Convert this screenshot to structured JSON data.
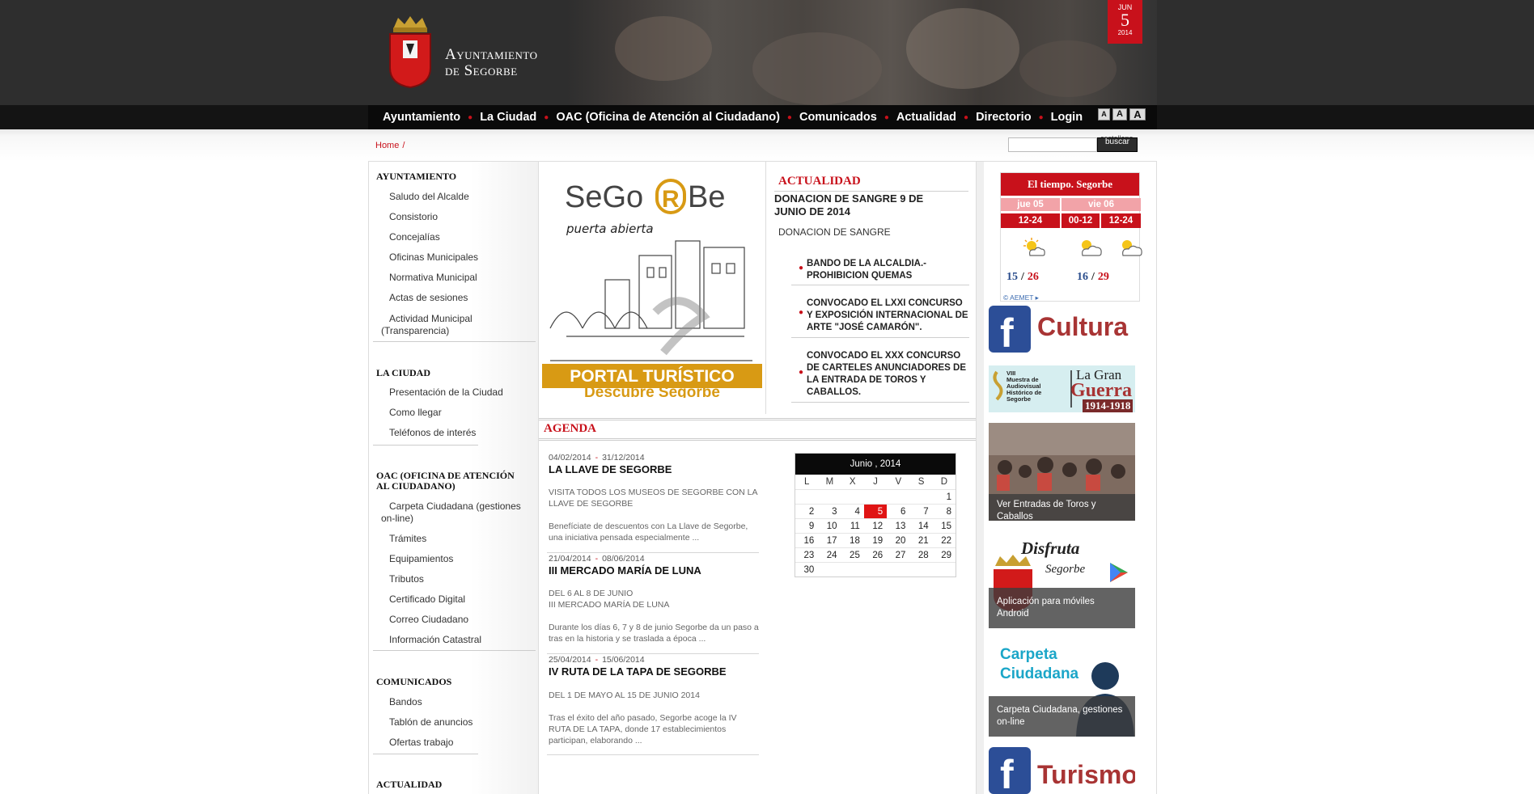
{
  "header": {
    "site_title_line1": "Ayuntamiento",
    "site_title_line2": "de Segorbe",
    "date": {
      "month": "JUN",
      "day": "5",
      "year": "2014"
    }
  },
  "nav": {
    "items": [
      "Ayuntamiento",
      "La Ciudad",
      "OAC (Oficina de Atención al Ciudadano)",
      "Comunicados",
      "Actualidad",
      "Directorio",
      "Login"
    ],
    "font_sizes": [
      "A",
      "A",
      "A"
    ]
  },
  "breadcrumb": {
    "home": "Home",
    "sep": "/"
  },
  "search": {
    "lang": "castellano",
    "button": "buscar",
    "placeholder": ""
  },
  "sidebar": {
    "sections": [
      {
        "title": "AYUNTAMIENTO",
        "items": [
          "Saludo del Alcalde",
          "Consistorio",
          "Concejalías",
          "Oficinas Municipales",
          "Normativa Municipal",
          "Actas de sesiones",
          "Actividad Municipal",
          "(Transparencia)"
        ]
      },
      {
        "title": "LA CIUDAD",
        "items": [
          "Presentación de la Ciudad",
          "Como llegar",
          "Teléfonos de interés"
        ]
      },
      {
        "title_line1": "OAC (OFICINA DE ATENCIÓN",
        "title_line2": "AL CIUDADANO)",
        "items": [
          "Carpeta Ciudadana (gestiones",
          "on-line)",
          "Trámites",
          "Equipamientos",
          "Tributos",
          "Certificado Digital",
          "Correo Ciudadano",
          "Información Catastral"
        ]
      },
      {
        "title": "COMUNICADOS",
        "items": [
          "Bandos",
          "Tablón de anuncios",
          "Ofertas trabajo"
        ]
      },
      {
        "title": "ACTUALIDAD"
      }
    ]
  },
  "portal": {
    "brand_a": "SeGo",
    "brand_b": "Be",
    "tagline": "puerta abierta",
    "banner_title": "PORTAL TURÍSTICO",
    "banner_sub": "Descubre Segorbe"
  },
  "actualidad": {
    "title": "ACTUALIDAD",
    "main_title": "DONACION DE SANGRE 9 DE JUNIO DE 2014",
    "main_sub": "DONACION DE SANGRE",
    "items": [
      "BANDO DE LA ALCALDIA.- PROHIBICION QUEMAS",
      "CONVOCADO EL LXXI CONCURSO Y EXPOSICIÓN INTERNACIONAL DE ARTE \"JOSÉ CAMARÓN\".",
      "CONVOCADO EL XXX CONCURSO DE CARTELES ANUNCIADORES DE LA ENTRADA DE TOROS Y CABALLOS."
    ]
  },
  "agenda": {
    "title": "AGENDA",
    "events": [
      {
        "from": "04/02/2014",
        "to": "31/12/2014",
        "title": "LA LLAVE DE SEGORBE",
        "sub": "VISITA TODOS LOS MUSEOS DE SEGORBE CON LA LLAVE DE SEGORBE",
        "text": "Benefíciate de descuentos con La Llave de Segorbe, una iniciativa pensada especialmente ..."
      },
      {
        "from": "21/04/2014",
        "to": "08/06/2014",
        "title": "III MERCADO MARÍA DE LUNA",
        "sub_line1": "DEL 6 AL 8 DE JUNIO",
        "sub_line2": "III MERCADO MARÍA DE LUNA",
        "text": "Durante los días 6, 7 y 8 de junio Segorbe da un paso a tras en la historia y se traslada a época ..."
      },
      {
        "from": "25/04/2014",
        "to": "15/06/2014",
        "title": "IV RUTA DE LA TAPA DE SEGORBE",
        "sub": "DEL 1 DE MAYO AL 15 DE JUNIO 2014",
        "text": "Tras el éxito del año pasado, Segorbe acoge la IV RUTA DE LA TAPA, donde 17 establecimientos participan, elaborando ..."
      }
    ]
  },
  "calendar": {
    "title": "Junio , 2014",
    "dow": [
      "L",
      "M",
      "X",
      "J",
      "V",
      "S",
      "D"
    ],
    "weeks": [
      [
        "",
        "",
        "",
        "",
        "",
        "",
        "1"
      ],
      [
        "2",
        "3",
        "4",
        "5",
        "6",
        "7",
        "8"
      ],
      [
        "9",
        "10",
        "11",
        "12",
        "13",
        "14",
        "15"
      ],
      [
        "16",
        "17",
        "18",
        "19",
        "20",
        "21",
        "22"
      ],
      [
        "23",
        "24",
        "25",
        "26",
        "27",
        "28",
        "29"
      ],
      [
        "30",
        "",
        "",
        "",
        "",
        "",
        ""
      ]
    ],
    "today": "5",
    "today_color": "#e01414"
  },
  "weather": {
    "title": "El tiempo. Segorbe",
    "days": [
      "jue 05",
      "vie 06"
    ],
    "hours": [
      "12-24",
      "00-12",
      "12-24"
    ],
    "temps": [
      {
        "min": "15",
        "max": "26"
      },
      {
        "min": "16",
        "max": "29"
      }
    ],
    "credit": "© AEMET"
  },
  "banners": {
    "cultura": "Cultura",
    "guerra_small": [
      "VIII",
      "Muestra de",
      "Audiovisual",
      "Histórico de",
      "Segorbe"
    ],
    "guerra_title1": "La Gran",
    "guerra_title2": "Guerra",
    "guerra_years": "1914-1918",
    "toros_caption": "Ver Entradas de Toros y Caballos",
    "disfruta_title": "Disfruta",
    "disfruta_sub": "Segorbe",
    "android_caption": "Aplicación para móviles Android",
    "carpeta_title1": "Carpeta",
    "carpeta_title2": "Ciudadana",
    "carpeta_caption": "Carpeta Ciudadana, gestiones on-line",
    "turismo": "Turismo"
  },
  "colors": {
    "brand_red": "#c8111b",
    "nav_bg": "#0a0a0a",
    "header_bg": "#2e2e2e",
    "gold": "#d89a14"
  }
}
